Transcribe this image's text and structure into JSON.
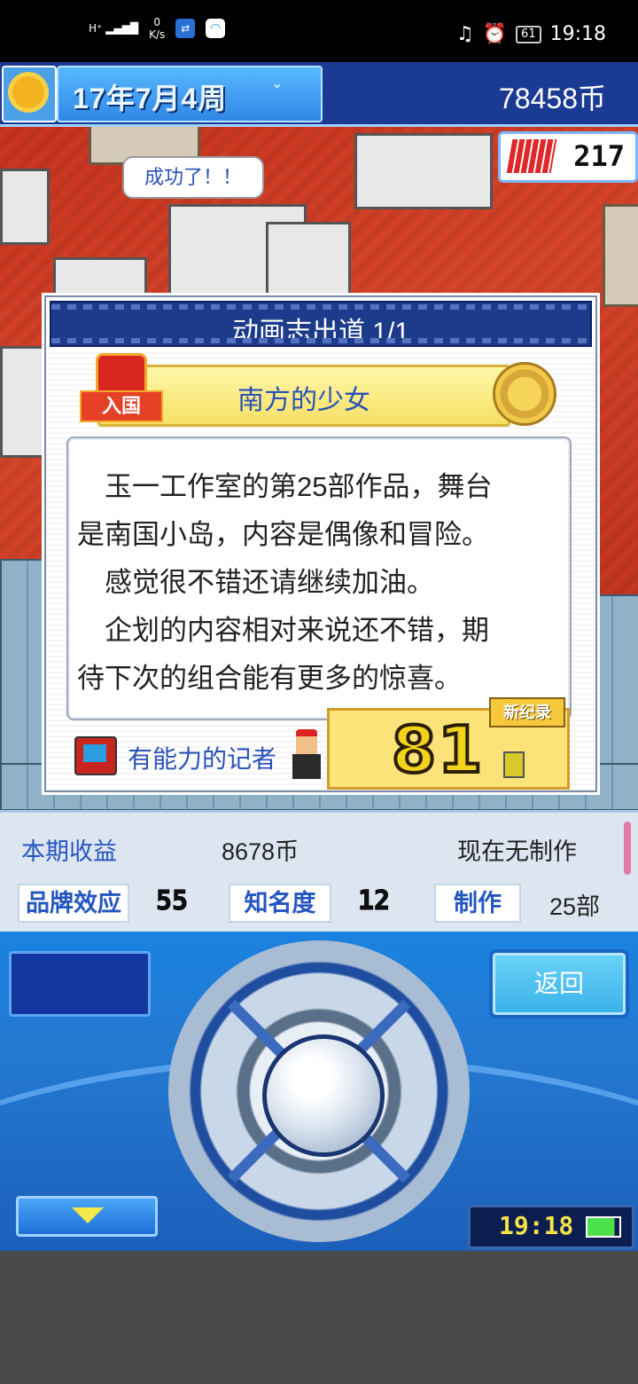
{
  "status_bar": {
    "signal": "H⁺ ▂▄▆█",
    "speed_value": "0",
    "speed_unit": "K/s",
    "battery": "61",
    "time": "19:18"
  },
  "top_bar": {
    "date": "17年7月4周",
    "money": "78458币",
    "fans": "217",
    "weather_icon": "sunflower-icon"
  },
  "speech_bubble": "成功了！！",
  "dialog": {
    "title": "动画志出道 1/1",
    "work_title": "南方的少女",
    "badge": "入国",
    "review_lines": [
      "　玉一工作室的第25部作品，舞台",
      "是南国小岛，内容是偶像和冒险。",
      "　感觉很不错还请继续加油。",
      "　企划的内容相对来说还不错，期",
      "待下次的组合能有更多的惊喜。"
    ],
    "critic": "有能力的记者",
    "score": "81",
    "new_record": "新纪录"
  },
  "info_panel": {
    "income_label": "本期收益",
    "income_value": "8678币",
    "status": "现在无制作",
    "brand_label": "品牌效应",
    "brand_value": "55",
    "fame_label": "知名度",
    "fame_value": "12",
    "works_label": "制作",
    "works_value": "25部"
  },
  "controller": {
    "back_label": "返回",
    "clock": "19:18"
  }
}
